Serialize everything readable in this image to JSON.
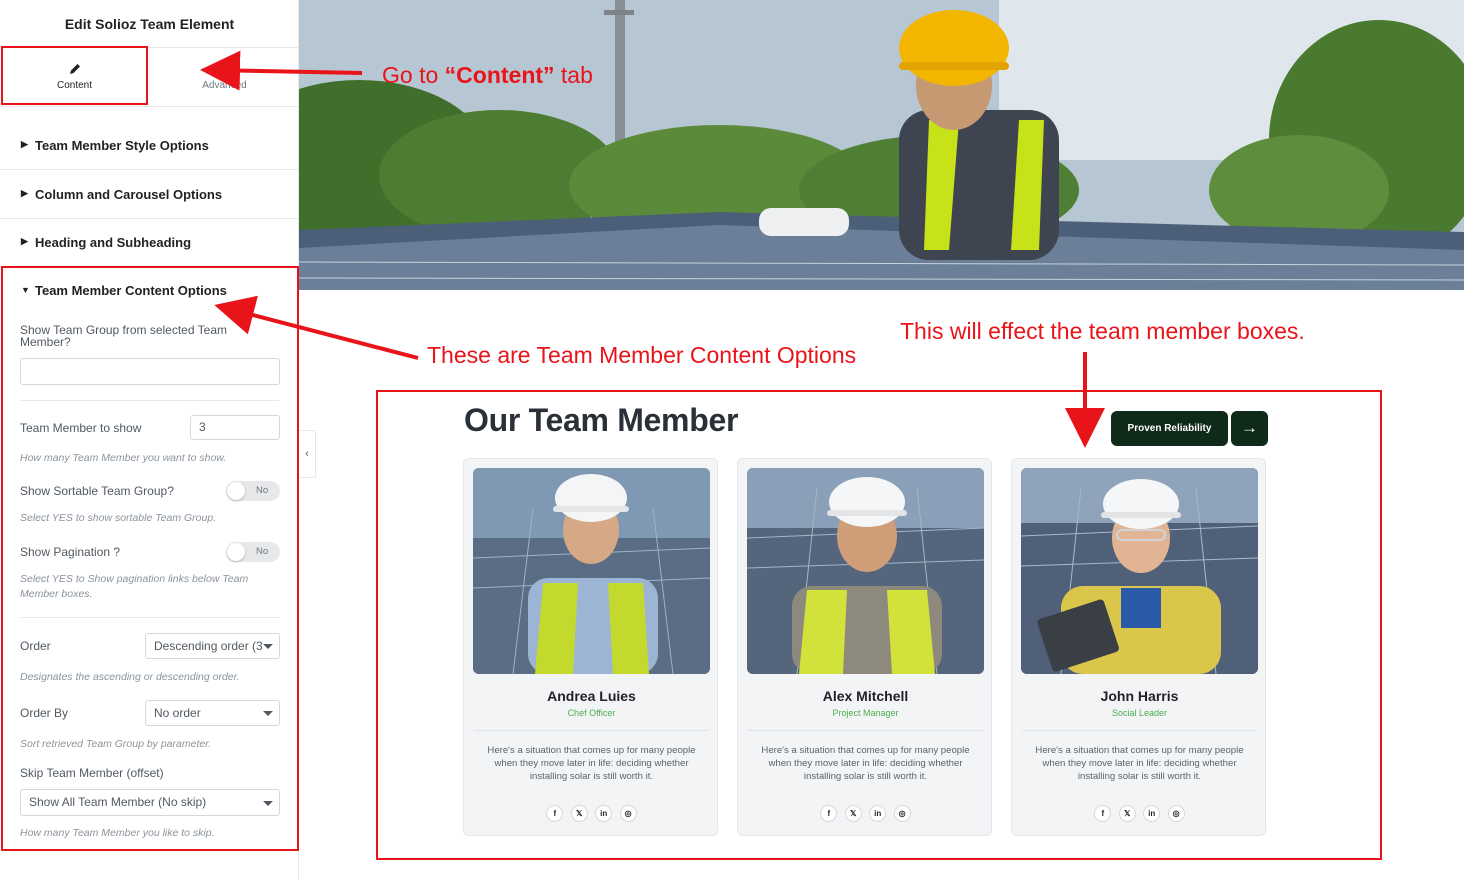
{
  "panel": {
    "title": "Edit Solioz Team Element",
    "tabs": [
      {
        "label": "Content",
        "icon": "pencil-icon"
      },
      {
        "label": "Advanced",
        "icon": "gear-icon"
      }
    ],
    "sections": [
      {
        "label": "Team Member Style Options"
      },
      {
        "label": "Column and Carousel Options"
      },
      {
        "label": "Heading and Subheading"
      },
      {
        "label": "Team Member Content Options"
      }
    ],
    "controls": {
      "team_group": {
        "label": "Show Team Group from selected Team Member?",
        "value": ""
      },
      "member_count": {
        "label": "Team Member to show",
        "value": "3",
        "hint": "How many Team Member you want to show."
      },
      "sortable": {
        "label": "Show Sortable Team Group?",
        "value": "No",
        "hint": "Select YES to show sortable Team Group."
      },
      "pagination": {
        "label": "Show Pagination ?",
        "value": "No",
        "hint": "Select YES to Show pagination links below Team Member boxes."
      },
      "order": {
        "label": "Order",
        "value": "Descending order (3",
        "hint": "Designates the ascending or descending order."
      },
      "order_by": {
        "label": "Order By",
        "value": "No order",
        "hint": "Sort retrieved Team Group by parameter."
      },
      "skip": {
        "label": "Skip Team Member (offset)",
        "value": "Show All Team Member (No skip)",
        "hint": "How many Team Member you like to skip."
      }
    }
  },
  "annotations": {
    "tab_prefix": "Go  to ",
    "tab_emph": "“Content”",
    "tab_suffix": " tab",
    "content_options": "These are Team Member Content Options",
    "boxes": "This will effect the team member boxes.",
    "color": "#e8141a"
  },
  "team": {
    "title": "Our Team Member",
    "cta_label": "Proven Reliability",
    "cta_color": "#0f2a18",
    "accent": "#4caf50",
    "members": [
      {
        "name": "Andrea Luies",
        "role": "Chef Officer",
        "desc": "Here's a situation that comes up for many people when they move later in life: deciding whether installing solar is still worth it."
      },
      {
        "name": "Alex Mitchell",
        "role": "Project Manager",
        "desc": "Here's a situation that comes up for many people when they move later in life: deciding whether installing solar is still worth it."
      },
      {
        "name": "John Harris",
        "role": "Social Leader",
        "desc": "Here's a situation that comes up for many people when they move later in life: deciding whether installing solar is still worth it."
      }
    ],
    "social": [
      "f",
      "𝕏",
      "in",
      "◎"
    ]
  }
}
